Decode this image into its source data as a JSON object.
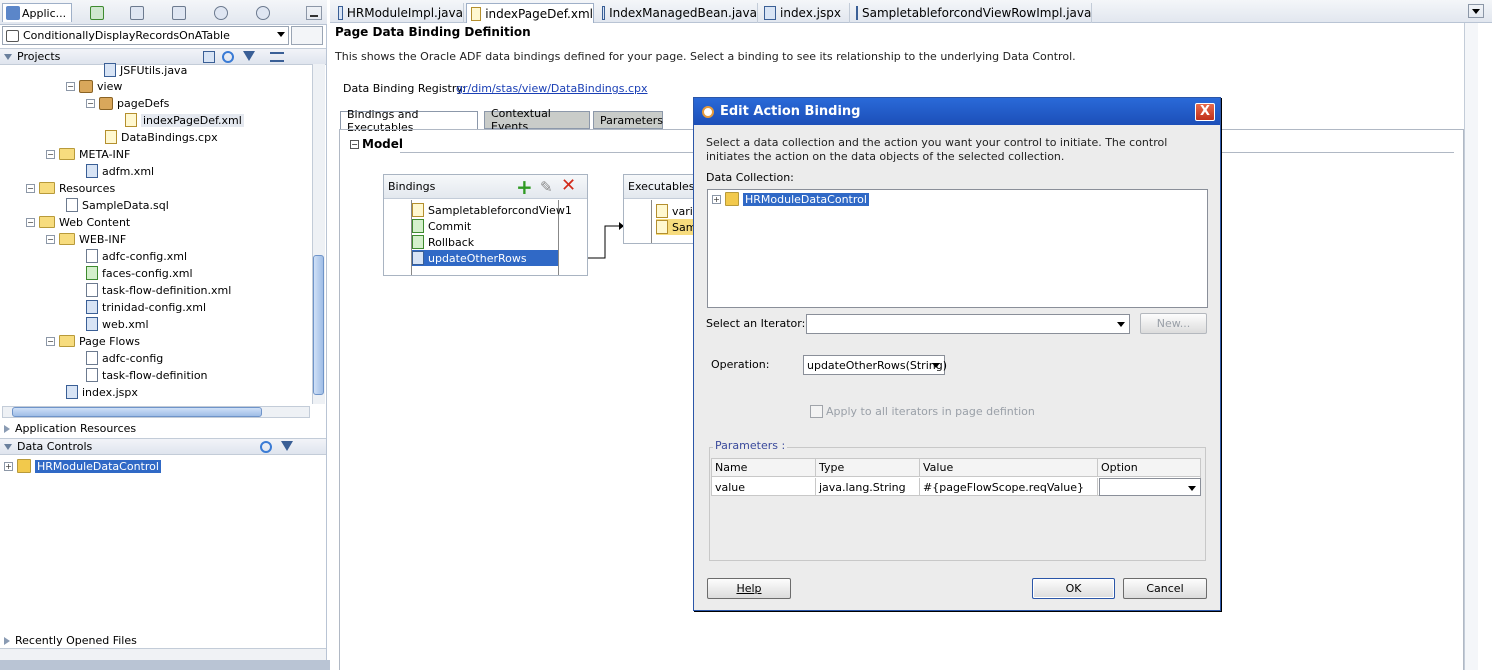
{
  "left": {
    "app_tab": "Applic...",
    "project_combo": "ConditionallyDisplayRecordsOnATable",
    "projects_header": "Projects",
    "tree": [
      {
        "label": "JSFUtils.java"
      },
      {
        "label": "view"
      },
      {
        "label": "pageDefs"
      },
      {
        "label": "indexPageDef.xml"
      },
      {
        "label": "DataBindings.cpx"
      },
      {
        "label": "META-INF"
      },
      {
        "label": "adfm.xml"
      },
      {
        "label": "Resources"
      },
      {
        "label": "SampleData.sql"
      },
      {
        "label": "Web Content"
      },
      {
        "label": "WEB-INF"
      },
      {
        "label": "adfc-config.xml"
      },
      {
        "label": "faces-config.xml"
      },
      {
        "label": "task-flow-definition.xml"
      },
      {
        "label": "trinidad-config.xml"
      },
      {
        "label": "web.xml"
      },
      {
        "label": "Page Flows"
      },
      {
        "label": "adfc-config"
      },
      {
        "label": "task-flow-definition"
      },
      {
        "label": "index.jspx"
      }
    ],
    "app_resources": "Application Resources",
    "data_controls": "Data Controls",
    "data_control_item": "HRModuleDataControl",
    "recent_files": "Recently Opened Files"
  },
  "editor_tabs": [
    {
      "label": "HRModuleImpl.java"
    },
    {
      "label": "indexPageDef.xml"
    },
    {
      "label": "IndexManagedBean.java"
    },
    {
      "label": "index.jspx"
    },
    {
      "label": "SampletableforcondViewRowImpl.java"
    }
  ],
  "editor": {
    "title": "Page Data Binding Definition",
    "description": "This shows the Oracle ADF data bindings defined for your page. Select a binding to see its relationship to the underlying Data Control.",
    "registry_label": "Data Binding Registry:",
    "registry_link": "gr/dim/stas/view/DataBindings.cpx",
    "subtabs": [
      "Bindings and Executables",
      "Contextual Events",
      "Parameters"
    ],
    "model_label": "Model",
    "bindings_title": "Bindings",
    "bindings": [
      "SampletableforcondView1",
      "Commit",
      "Rollback",
      "updateOtherRows"
    ],
    "executables_title": "Executables",
    "executables": [
      "varia",
      "Sam"
    ]
  },
  "dialog": {
    "title": "Edit Action Binding",
    "close": "X",
    "instructions": "Select a data collection and the action you want your control to initiate. The control initiates the action on the data objects of the selected collection.",
    "data_collection_label": "Data Collection:",
    "data_collection_item": "HRModuleDataControl",
    "iterator_label": "Select an Iterator:",
    "iterator_value": "",
    "new_button": "New...",
    "operation_label": "Operation:",
    "operation_value": "updateOtherRows(String)",
    "apply_all_label": "Apply to all iterators in page defintion",
    "parameters_label": "Parameters :",
    "param_columns": [
      "Name",
      "Type",
      "Value",
      "Option"
    ],
    "param_rows": [
      {
        "name": "value",
        "type": "java.lang.String",
        "value": "#{pageFlowScope.reqValue}",
        "option": ""
      }
    ],
    "help_button": "Help",
    "ok_button": "OK",
    "cancel_button": "Cancel"
  }
}
